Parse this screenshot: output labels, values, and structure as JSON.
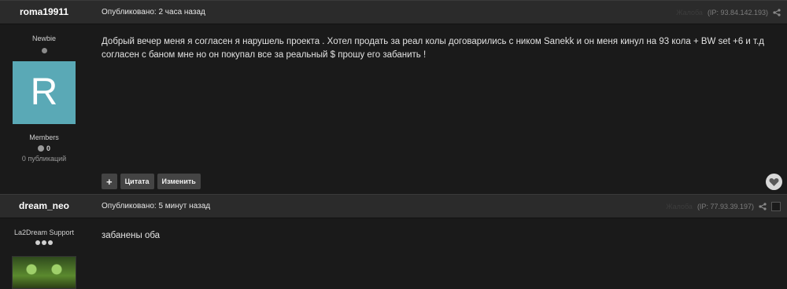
{
  "posts": [
    {
      "author": "roma19911",
      "posted_label": "Опубликовано: 2 часа назад",
      "report_label": "Жалоба",
      "ip_label": "(IP: 93.84.142.193)",
      "rank_title": "Newbie",
      "avatar_letter": "R",
      "avatar_color": "#5aa9b6",
      "group": "Members",
      "reputation": "0",
      "post_count": "0 публикаций",
      "text": "Добрый вечер меня я согласен я нарушель проекта . Хотел продать за реал колы договарились с ником Sanekk  и он меня кинул на 93 кола + BW set +6  и т.д  согласен с баном мне но он покупал все за реальный $ прошу его забанить !",
      "actions": {
        "plus": "+",
        "quote": "Цитата",
        "edit": "Изменить"
      }
    },
    {
      "author": "dream_neo",
      "posted_label": "Опубликовано: 5 минут назад",
      "report_label": "Жалоба",
      "ip_label": "(IP: 77.93.39.197)",
      "rank_title": "La2Dream Support",
      "text": "забанены оба"
    }
  ],
  "icons": {
    "share": "share-icon",
    "like": "heart-icon",
    "moderate": "checkbox"
  }
}
